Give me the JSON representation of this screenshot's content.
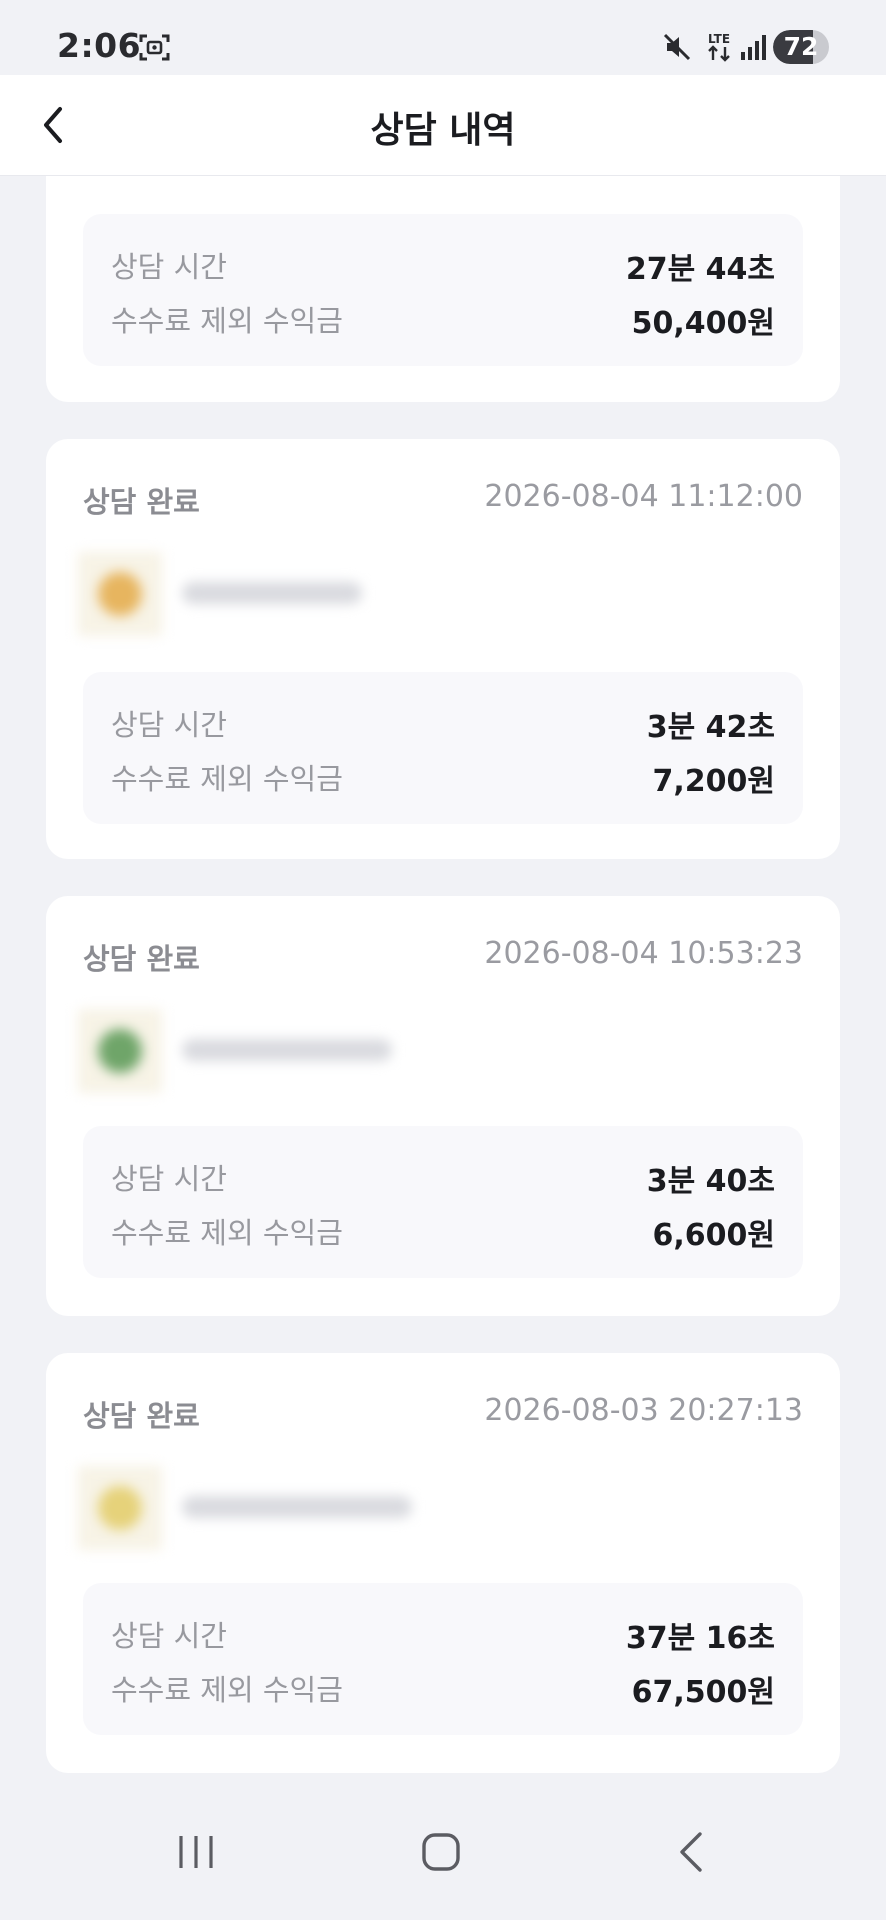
{
  "status_bar": {
    "time": "2:06",
    "lte_label": "LTE",
    "battery": "72",
    "battery_level": 0.72,
    "icons": [
      "screenshot-icon",
      "mute-icon",
      "lte-icon",
      "signal-icon",
      "battery-icon"
    ]
  },
  "header": {
    "title": "상담 내역",
    "back_icon": "chevron-left-icon"
  },
  "consultations": [
    {
      "status": "",
      "date": "",
      "duration_label": "상담 시간",
      "duration": "27분 44초",
      "earnings_label": "수수료 제외 수익금",
      "earnings": "50,400원"
    },
    {
      "status": "상담 완료",
      "date": "2026-08-04 11:12:00",
      "avatar_color": "#e7b55f",
      "duration_label": "상담 시간",
      "duration": "3분 42초",
      "earnings_label": "수수료 제외 수익금",
      "earnings": "7,200원"
    },
    {
      "status": "상담 완료",
      "date": "2026-08-04 10:53:23",
      "avatar_color": "#6fa569",
      "duration_label": "상담 시간",
      "duration": "3분 40초",
      "earnings_label": "수수료 제외 수익금",
      "earnings": "6,600원"
    },
    {
      "status": "상담 완료",
      "date": "2026-08-03 20:27:13",
      "avatar_color": "#e6d27a",
      "duration_label": "상담 시간",
      "duration": "37분 16초",
      "earnings_label": "수수료 제외 수익금",
      "earnings": "67,500원"
    }
  ],
  "nav_bar": {
    "icons": [
      "recent-apps-icon",
      "home-icon",
      "back-icon"
    ]
  },
  "colors": {
    "background": "#f1f2f6",
    "card": "#ffffff",
    "info_box": "#f8f8fb",
    "text_primary": "#1b1c20",
    "text_secondary": "#98999f"
  }
}
